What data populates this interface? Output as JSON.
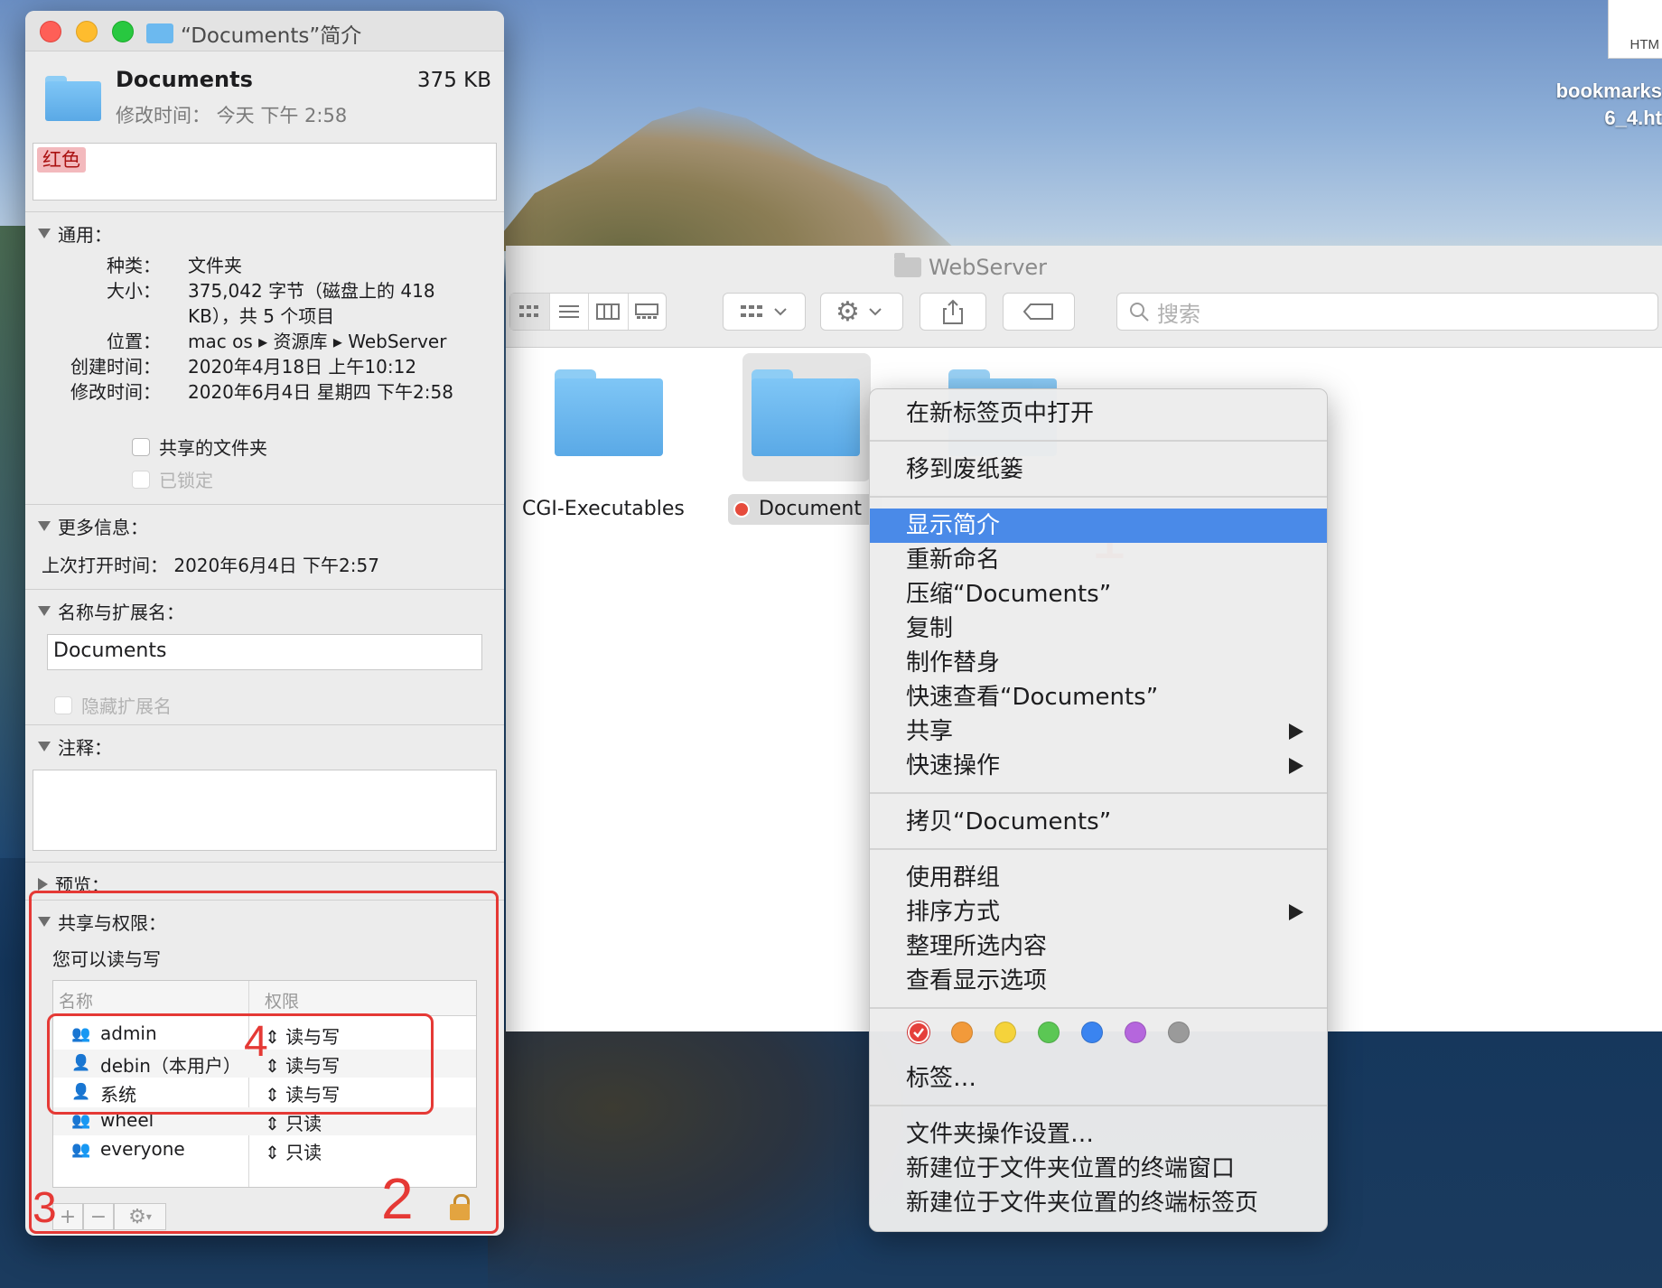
{
  "desktop": {
    "file_ext": "HTM",
    "file_name_line1": "bookmarks",
    "file_name_line2": "6_4.ht"
  },
  "finder": {
    "title": "WebServer",
    "search_placeholder": "搜索",
    "items": [
      {
        "name": "CGI-Executables"
      },
      {
        "name": "Document",
        "tag_color": "#e64b3c"
      }
    ]
  },
  "info": {
    "window_title": "“Documents”简介",
    "name": "Documents",
    "size": "375 KB",
    "modified": "修改时间：  今天 下午 2:58",
    "tag": "红色",
    "general": {
      "header": "通用：",
      "kind_k": "种类：",
      "kind_v": "文件夹",
      "size_k": "大小：",
      "size_v1": "375,042 字节（磁盘上的 418",
      "size_v2": "KB），共 5 个项目",
      "where_k": "位置：",
      "where_v": "mac os ▸ 资源库 ▸ WebServer",
      "created_k": "创建时间：",
      "created_v": "2020年4月18日 上午10:12",
      "modified_k": "修改时间：",
      "modified_v": "2020年6月4日 星期四 下午2:58",
      "shared_folder": "共享的文件夹",
      "locked": "已锁定"
    },
    "more_info": {
      "header": "更多信息：",
      "last_opened": "上次打开时间：  2020年6月4日 下午2:57"
    },
    "name_ext": {
      "header": "名称与扩展名：",
      "value": "Documents",
      "hide_ext": "隐藏扩展名"
    },
    "comments": {
      "header": "注释："
    },
    "preview": {
      "header": "预览："
    },
    "sharing": {
      "header": "共享与权限：",
      "note": "您可以读与写",
      "col_name": "名称",
      "col_perm": "权限",
      "rows": [
        {
          "name": "admin",
          "perm": "读与写",
          "icon": "group-icon"
        },
        {
          "name": "debin（本用户）",
          "perm": "读与写",
          "icon": "user-icon"
        },
        {
          "name": "系统",
          "perm": "读与写",
          "icon": "user-icon"
        },
        {
          "name": "wheel",
          "perm": "只读",
          "icon": "group-icon"
        },
        {
          "name": "everyone",
          "perm": "只读",
          "icon": "group-icon"
        }
      ]
    }
  },
  "annotations": {
    "n1": "1",
    "n2": "2",
    "n3": "3",
    "n4": "4",
    "color": "#e53935"
  },
  "context_menu": {
    "open_new_tab": "在新标签页中打开",
    "move_to_trash": "移到废纸篓",
    "get_info": "显示简介",
    "rename": "重新命名",
    "compress": "压缩“Documents”",
    "duplicate": "复制",
    "make_alias": "制作替身",
    "quick_look": "快速查看“Documents”",
    "share": "共享",
    "quick_actions": "快速操作",
    "copy": "拷贝“Documents”",
    "use_groups": "使用群组",
    "sort_by": "排序方式",
    "clean_up": "整理所选内容",
    "view_options": "查看显示选项",
    "tags": "标签…",
    "folder_actions": "文件夹操作设置…",
    "new_terminal": "新建位于文件夹位置的终端窗口",
    "new_terminal_tab": "新建位于文件夹位置的终端标签页",
    "tag_colors": [
      "#e5403b",
      "#f29a3a",
      "#f5d33b",
      "#5bc754",
      "#3a84f0",
      "#b566dd",
      "#9a9a9a"
    ]
  }
}
